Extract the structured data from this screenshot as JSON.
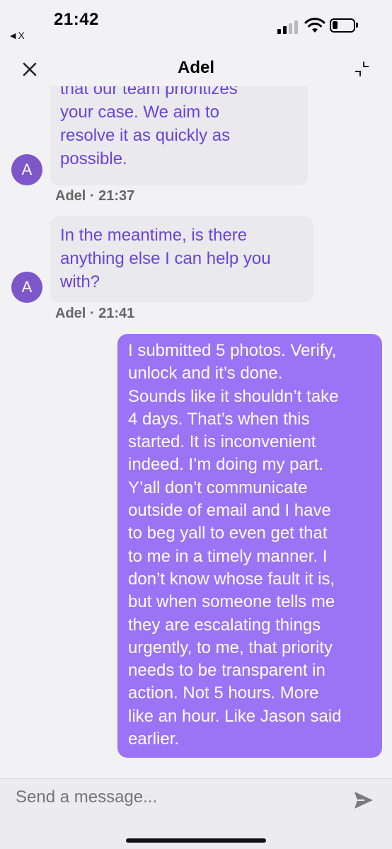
{
  "status_bar": {
    "time": "21:42",
    "back_app_label": "X"
  },
  "header": {
    "title": "Adel",
    "close_icon": "close-icon",
    "minimize_icon": "minimize-icon"
  },
  "messages": [
    {
      "lines": [
        "that our team prioritizes",
        "your case. We aim to",
        "resolve it as quickly as",
        "possible."
      ],
      "avatar": "A",
      "meta": "Adel · 21:37"
    },
    {
      "lines": [
        "In the meantime, is there",
        "anything else I can help you",
        "with?"
      ],
      "avatar": "A",
      "meta": "Adel · 21:41"
    }
  ],
  "outgoing": {
    "lines": [
      "I submitted 5 photos. Verify,",
      "unlock and it’s done.",
      "Sounds like it shouldn’t take",
      "4 days. That’s when this",
      "started. It is inconvenient",
      "indeed. I’m doing my part.",
      "Y’all don’t communicate",
      "outside of email and I have",
      "to beg yall to even get that",
      "to me in a timely manner. I",
      "don’t know whose fault it is,",
      "but when someone tells me",
      "they are escalating things",
      "urgently, to me, that priority",
      "needs to be transparent in",
      "action. Not 5 hours. More",
      "like an hour. Like Jason said",
      "earlier."
    ]
  },
  "composer": {
    "placeholder": "Send a message...",
    "send_icon": "send-icon"
  },
  "colors": {
    "agent_text": "#6a44d8",
    "agent_bubble": "#e9e9ee",
    "user_bubble": "#9b73f5",
    "avatar": "#7d56c9"
  }
}
